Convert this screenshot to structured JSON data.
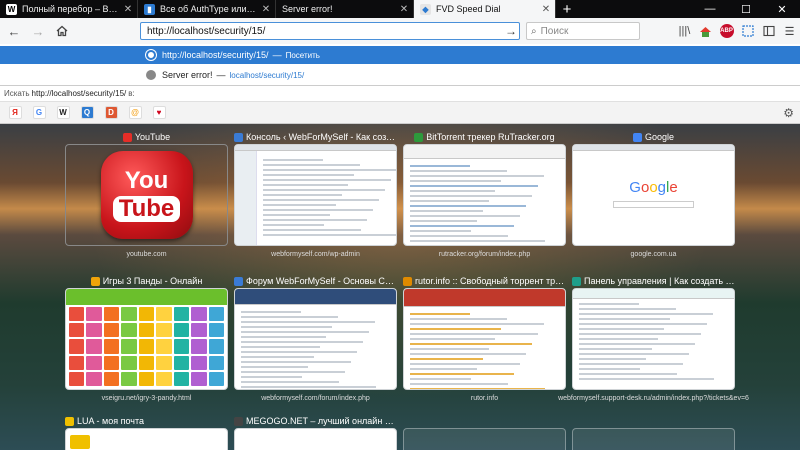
{
  "tabs": [
    {
      "title": "Полный перебор – Википед",
      "icon": "W",
      "active": false
    },
    {
      "title": "Все об AuthType или авториз",
      "icon": "bookmark",
      "active": false
    },
    {
      "title": "Server error!",
      "icon": "",
      "active": false
    },
    {
      "title": "FVD Speed Dial",
      "icon": "fvd",
      "active": true
    }
  ],
  "new_tab_label": "+",
  "window_controls": {
    "minimize": "—",
    "maximize": "☐",
    "close": "✕"
  },
  "navbar": {
    "url": "http://localhost/security/15/",
    "search_placeholder": "Поиск"
  },
  "dropdown": [
    {
      "main": "http://localhost/security/15/",
      "sep": "—",
      "sub": "Посетить",
      "selected": true
    },
    {
      "main": "Server error!",
      "sep": "—",
      "sub": "localhost/security/15/",
      "selected": false
    }
  ],
  "search_with": {
    "prefix": "Искать",
    "query": "http://localhost/security/15/",
    "suffix": "в:"
  },
  "engines": [
    {
      "name": "yandex",
      "label": "Я",
      "bg": "#ffffff",
      "fg": "#e2231a"
    },
    {
      "name": "google",
      "label": "G",
      "bg": "#ffffff",
      "fg": "#4285f4"
    },
    {
      "name": "wikipedia",
      "label": "W",
      "bg": "#ffffff",
      "fg": "#222222"
    },
    {
      "name": "search-blue",
      "label": "Q",
      "bg": "#2d7bd1",
      "fg": "#ffffff"
    },
    {
      "name": "duckduckgo",
      "label": "D",
      "bg": "#de5833",
      "fg": "#ffffff"
    },
    {
      "name": "mail",
      "label": "@",
      "bg": "#ffffff",
      "fg": "#f5a623"
    },
    {
      "name": "gift",
      "label": "♥",
      "bg": "#ffffff",
      "fg": "#d0021b"
    }
  ],
  "tiles": [
    {
      "title": "YouTube",
      "url": "youtube.com",
      "fav_color": "#e52d27",
      "kind": "youtube",
      "yt_top": "You",
      "yt_bottom": "Tube"
    },
    {
      "title": "Консоль ‹ WebForMySelf - Как создат...",
      "url": "webformyself.com/wp-admin",
      "fav_color": "#3a7bd5",
      "kind": "wp"
    },
    {
      "title": "BitTorrent трекер RuTracker.org",
      "url": "rutracker.org/forum/index.php",
      "fav_color": "#2d9a3c",
      "kind": "rutracker"
    },
    {
      "title": "Google",
      "url": "google.com.ua",
      "fav_color": "#4285f4",
      "kind": "google",
      "logo": [
        "G",
        "o",
        "o",
        "g",
        "l",
        "e"
      ]
    },
    {
      "title": "Игры 3 Панды - Онлайн",
      "url": "vseigru.net/igry-3-pandy.html",
      "fav_color": "#f0a30a",
      "kind": "games"
    },
    {
      "title": "Форум WebForMySelf - Основы Самос...",
      "url": "webformyself.com/forum/index.php",
      "fav_color": "#3a7bd5",
      "kind": "forum"
    },
    {
      "title": "rutor.info :: Свободный торрент трекер",
      "url": "rutor.info",
      "fav_color": "#e08a00",
      "kind": "rutor"
    },
    {
      "title": "Панель управления | Как создать св...",
      "url": "webformyself.support-desk.ru/admin/index.php?/tickets&ev=6",
      "fav_color": "#1e9e8a",
      "kind": "support"
    },
    {
      "title": "LUA - моя почта",
      "url": "",
      "fav_color": "#f0c000",
      "kind": "partial"
    },
    {
      "title": "MEGOGO.NET – лучший онлайн кинот...",
      "url": "",
      "fav_color": "#444444",
      "kind": "partial"
    }
  ],
  "colors": {
    "accent": "#2d7bd1",
    "tab_strip": "#0c0c0d",
    "toolbar": "#f5f6f7"
  }
}
